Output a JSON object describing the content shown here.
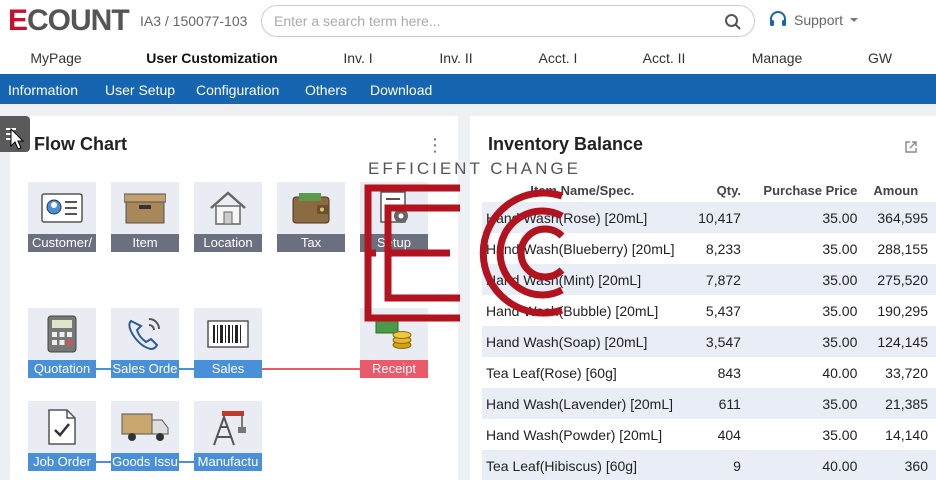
{
  "header": {
    "logo": "ECOUNT",
    "company": "IA3 / 150077-103",
    "search_placeholder": "Enter a search term here...",
    "support_label": "Support"
  },
  "main_nav": [
    "MyPage",
    "User Customization",
    "Inv. I",
    "Inv. II",
    "Acct. I",
    "Acct. II",
    "Manage",
    "GW"
  ],
  "main_nav_active": "User Customization",
  "sub_nav": [
    "Information",
    "User Setup",
    "Configuration",
    "Others",
    "Download"
  ],
  "flow_chart": {
    "title": "Flow Chart",
    "row1": [
      {
        "label": "Customer/",
        "icon": "contact-card-icon"
      },
      {
        "label": "Item",
        "icon": "box-icon"
      },
      {
        "label": "Location",
        "icon": "house-icon"
      },
      {
        "label": "Tax",
        "icon": "wallet-icon"
      },
      {
        "label": "Setup",
        "icon": "gear-document-icon"
      }
    ],
    "row2": [
      {
        "label": "Quotation",
        "icon": "calculator-icon"
      },
      {
        "label": "Sales Orde",
        "icon": "phone-icon"
      },
      {
        "label": "Sales",
        "icon": "barcode-icon"
      },
      {
        "label": "Receipt",
        "icon": "coins-icon"
      }
    ],
    "row3": [
      {
        "label": "Job Order",
        "icon": "checklist-icon"
      },
      {
        "label": "Goods Issu",
        "icon": "truck-icon"
      },
      {
        "label": "Manufactu",
        "icon": "crane-icon"
      }
    ]
  },
  "inventory": {
    "title": "Inventory Balance",
    "columns": [
      "Item Name/Spec.",
      "Qty.",
      "Purchase Price",
      "Amoun"
    ],
    "rows": [
      [
        "Hand Wash(Rose) [20mL]",
        "10,417",
        "35.00",
        "364,595"
      ],
      [
        "Hand Wash(Blueberry) [20mL]",
        "8,233",
        "35.00",
        "288,155"
      ],
      [
        "Hand Wash(Mint) [20mL]",
        "7,872",
        "35.00",
        "275,520"
      ],
      [
        "Hand Wash(Bubble) [20mL]",
        "5,437",
        "35.00",
        "190,295"
      ],
      [
        "Hand Wash(Soap) [20mL]",
        "3,547",
        "35.00",
        "124,145"
      ],
      [
        "Tea Leaf(Rose) [60g]",
        "843",
        "40.00",
        "33,720"
      ],
      [
        "Hand Wash(Lavender) [20mL]",
        "611",
        "35.00",
        "21,385"
      ],
      [
        "Hand Wash(Powder) [20mL]",
        "404",
        "35.00",
        "14,140"
      ],
      [
        "Tea Leaf(Hibiscus) [60g]",
        "9",
        "40.00",
        "360"
      ]
    ]
  },
  "watermark": {
    "tagline": "EFFICIENT CHANGE",
    "mark": "EC"
  },
  "colors": {
    "brand_red": "#c8102e",
    "subnav_blue": "#1565b0",
    "flow_blue": "#4a90d9",
    "flow_red": "#ea5a6a",
    "flow_gray": "#6b7080"
  }
}
